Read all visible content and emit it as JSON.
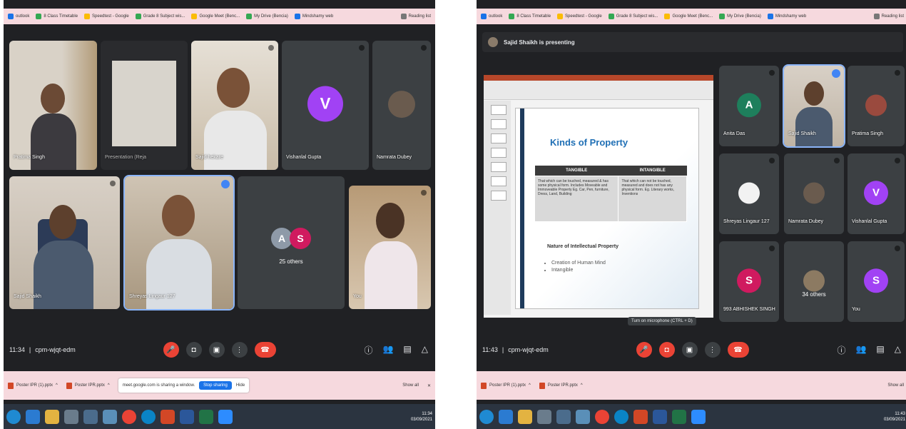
{
  "bookmarks": [
    {
      "label": "outlook",
      "color": "#1a73e8"
    },
    {
      "label": "8 Class Timetable",
      "color": "#34a853"
    },
    {
      "label": "Speedtest - Google",
      "color": "#fbbc04"
    },
    {
      "label": "Grade 8 Subject wis...",
      "color": "#34a853"
    },
    {
      "label": "Google Meet (Benc...",
      "color": "#fbbc04"
    },
    {
      "label": "My Drive (Bencia)",
      "color": "#34a853"
    },
    {
      "label": "Mindshamy web",
      "color": "#1a73e8"
    }
  ],
  "reading_list": "Reading list",
  "left": {
    "tiles": {
      "pratima": "Pratima Singh",
      "presentation": "Presentation (Reja",
      "third": "Sajid hekare",
      "vishanlal": "Vishanlal Gupta",
      "vishanlal_initial": "V",
      "namrata": "Namrata Dubey",
      "sajid": "Sajid Shaikh",
      "shreyas": "Shreyas Lingaur 127",
      "others_a": "A",
      "others_s": "S",
      "others_label": "25 others",
      "you": "You"
    },
    "time": "11:34",
    "code": "cpm-wjqt-edm"
  },
  "right": {
    "presenting": "Sajid Shaikh is presenting",
    "tiles": {
      "anita": "Anita Das",
      "anita_initial": "A",
      "sajid": "Sajid Shaikh",
      "pratima": "Pratima Singh",
      "shreyas": "Shreyas Lingaur 127",
      "namrata": "Namrata Dubey",
      "vishanlal": "Vishanlal Gupta",
      "vishanlal_initial": "V",
      "abhishek": "993 ABHISHEK SINGH",
      "abhishek_initial": "S",
      "others_label": "34 others",
      "you": "You",
      "you_initial": "S"
    },
    "tooltip": "Turn on microphone (CTRL + D)",
    "time": "11:43",
    "code": "cpm-wjqt-edm"
  },
  "slide": {
    "title": "Kinds of Property",
    "col1": "TANGIBLE",
    "col2": "INTANGIBLE",
    "cell1": "That which can be touched, measured & has some physical form. Includes Moveable and Immoveable Property Eg. Car, Pen, furniture, Dress, Land, Building",
    "cell2": "That which can not be touched, measured and does not has any physical form. Eg. Literary works, Inventions",
    "subtitle": "Nature of Intellectual Property",
    "bullet1": "Creation of Human Mind",
    "bullet2": "Intangible"
  },
  "downloads": {
    "left_file1": "Poster IPR (1).pptx",
    "left_file2": "Poster IPR.pptx",
    "share_msg": "meet.google.com is sharing a window.",
    "stop": "Stop sharing",
    "hide": "Hide",
    "show_all": "Show all",
    "right_file1": "Poster IPR (1).pptx",
    "right_file2": "Poster IPR.pptx"
  },
  "tray_left": {
    "time": "11:34",
    "date": "03/09/2021",
    "lang": "EN"
  },
  "tray_right": {
    "time": "11:43",
    "date": "03/09/2021",
    "lang": "EN"
  },
  "colors": {
    "meet_bg": "#202124",
    "tile_bg": "#3c4043",
    "end_call": "#ea4335",
    "purple": "#a142f4",
    "teal": "#1e7f5c",
    "magenta": "#d01a5f",
    "accent": "#8ab4f8"
  }
}
